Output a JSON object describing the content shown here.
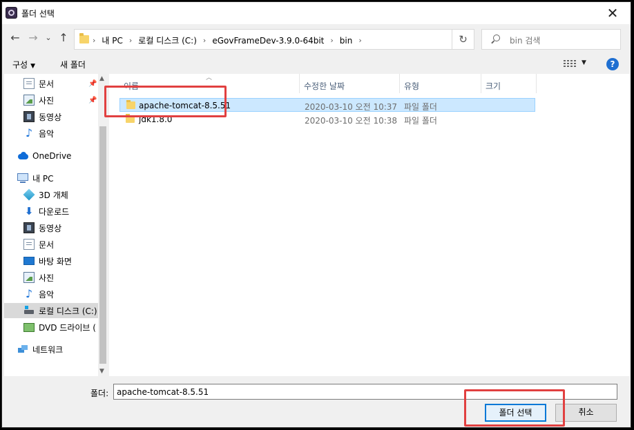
{
  "window": {
    "title": "폴더 선택",
    "close_icon": "close-icon"
  },
  "nav": {
    "back": "←",
    "forward": "→",
    "down": "⌄",
    "up": "↑"
  },
  "address": {
    "crumbs": [
      "내 PC",
      "로컬 디스크 (C:)",
      "eGovFrameDev-3.9.0-64bit",
      "bin"
    ],
    "separator": "›",
    "dropdown": "⌄",
    "refresh": "↻"
  },
  "search": {
    "placeholder": "bin 검색"
  },
  "toolbar": {
    "organize": "구성",
    "new_folder": "새 폴더",
    "help": "?"
  },
  "sidebar": {
    "quick_access": [
      {
        "label": "문서",
        "icon": "document-icon",
        "pinned": true
      },
      {
        "label": "사진",
        "icon": "pictures-icon",
        "pinned": true
      },
      {
        "label": "동영상",
        "icon": "video-icon",
        "pinned": false
      },
      {
        "label": "음악",
        "icon": "music-icon",
        "pinned": false
      }
    ],
    "onedrive": {
      "label": "OneDrive",
      "icon": "onedrive-icon"
    },
    "this_pc": {
      "label": "내 PC",
      "icon": "computer-icon"
    },
    "pc_items": [
      {
        "label": "3D 개체",
        "icon": "3d-objects-icon"
      },
      {
        "label": "다운로드",
        "icon": "download-icon"
      },
      {
        "label": "동영상",
        "icon": "video-icon"
      },
      {
        "label": "문서",
        "icon": "document-icon"
      },
      {
        "label": "바탕 화면",
        "icon": "desktop-icon"
      },
      {
        "label": "사진",
        "icon": "pictures-icon"
      },
      {
        "label": "음악",
        "icon": "music-icon"
      },
      {
        "label": "로컬 디스크 (C:)",
        "icon": "local-disk-icon",
        "selected": true
      },
      {
        "label": "DVD 드라이브 (",
        "icon": "dvd-drive-icon"
      }
    ],
    "network": {
      "label": "네트워크",
      "icon": "network-icon"
    }
  },
  "columns": {
    "name": "이름",
    "modified": "수정한 날짜",
    "type": "유형",
    "size": "크기"
  },
  "files": [
    {
      "name": "apache-tomcat-8.5.51",
      "modified": "2020-03-10 오전 10:37",
      "type": "파일 폴더",
      "size": "",
      "selected": true
    },
    {
      "name": "jdk1.8.0",
      "modified": "2020-03-10 오전 10:38",
      "type": "파일 폴더",
      "size": "",
      "selected": false
    }
  ],
  "footer": {
    "folder_label": "폴더:",
    "folder_value": "apache-tomcat-8.5.51",
    "select_button": "폴더 선택",
    "cancel_button": "취소"
  },
  "colors": {
    "highlight": "#e14040",
    "selection": "#cce8ff",
    "accent": "#0078d7"
  }
}
